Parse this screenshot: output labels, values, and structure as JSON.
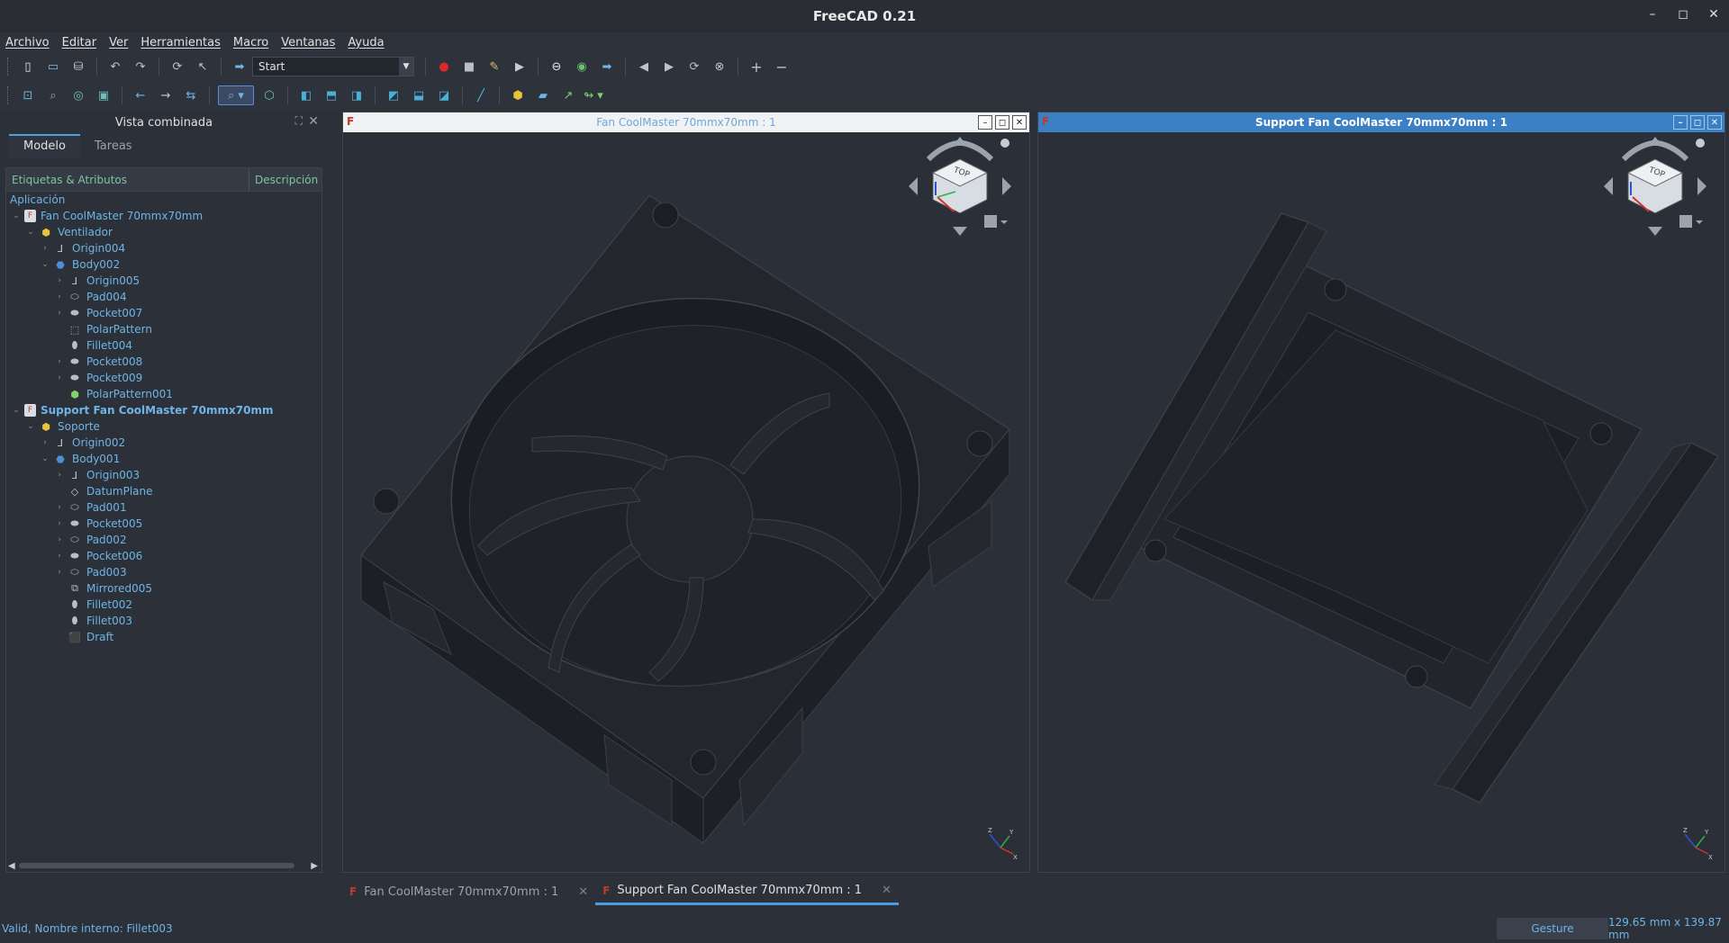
{
  "window": {
    "title": "FreeCAD 0.21"
  },
  "menu": [
    "Archivo",
    "Editar",
    "Ver",
    "Herramientas",
    "Macro",
    "Ventanas",
    "Ayuda"
  ],
  "toolbar": {
    "workbench": "Start"
  },
  "panel": {
    "title": "Vista combinada",
    "tabs": [
      "Modelo",
      "Tareas"
    ],
    "col_labels": "Etiquetas & Atributos",
    "col_desc": "Descripción",
    "app_label": "Aplicación"
  },
  "tree": [
    {
      "label": "Fan CoolMaster 70mmx70mm",
      "icon": "doc-icon",
      "depth": 0,
      "expanded": true,
      "bold": false
    },
    {
      "label": "Ventilador",
      "icon": "part-icon",
      "depth": 1,
      "expanded": true,
      "bold": false
    },
    {
      "label": "Origin004",
      "icon": "origin-icon",
      "depth": 2,
      "expander": "collapsed",
      "bold": false
    },
    {
      "label": "Body002",
      "icon": "body-icon",
      "depth": 2,
      "expanded": true,
      "bold": false
    },
    {
      "label": "Origin005",
      "icon": "origin-icon",
      "depth": 3,
      "expander": "collapsed",
      "bold": false
    },
    {
      "label": "Pad004",
      "icon": "pad-icon",
      "depth": 3,
      "expander": "collapsed",
      "bold": false
    },
    {
      "label": "Pocket007",
      "icon": "pocket-icon",
      "depth": 3,
      "expander": "collapsed",
      "bold": false
    },
    {
      "label": "PolarPattern",
      "icon": "polar-pattern-icon",
      "depth": 3,
      "expander": "none",
      "bold": false
    },
    {
      "label": "Fillet004",
      "icon": "fillet-icon",
      "depth": 3,
      "expander": "none",
      "bold": false
    },
    {
      "label": "Pocket008",
      "icon": "pocket-icon",
      "depth": 3,
      "expander": "collapsed",
      "bold": false
    },
    {
      "label": "Pocket009",
      "icon": "pocket-icon",
      "depth": 3,
      "expander": "collapsed",
      "bold": false
    },
    {
      "label": "PolarPattern001",
      "icon": "polar-pattern-tip-icon",
      "depth": 3,
      "expander": "none",
      "bold": false
    },
    {
      "label": "Support Fan CoolMaster 70mmx70mm",
      "icon": "doc-icon",
      "depth": 0,
      "expanded": true,
      "bold": true
    },
    {
      "label": "Soporte",
      "icon": "part-icon",
      "depth": 1,
      "expanded": true,
      "bold": false
    },
    {
      "label": "Origin002",
      "icon": "origin-icon",
      "depth": 2,
      "expander": "collapsed",
      "bold": false
    },
    {
      "label": "Body001",
      "icon": "body-icon",
      "depth": 2,
      "expanded": true,
      "bold": false
    },
    {
      "label": "Origin003",
      "icon": "origin-icon",
      "depth": 3,
      "expander": "collapsed",
      "bold": false
    },
    {
      "label": "DatumPlane",
      "icon": "datum-plane-icon",
      "depth": 3,
      "expander": "none",
      "bold": false
    },
    {
      "label": "Pad001",
      "icon": "pad-icon",
      "depth": 3,
      "expander": "collapsed",
      "bold": false
    },
    {
      "label": "Pocket005",
      "icon": "pocket-icon",
      "depth": 3,
      "expander": "collapsed",
      "bold": false
    },
    {
      "label": "Pad002",
      "icon": "pad-icon",
      "depth": 3,
      "expander": "collapsed",
      "bold": false
    },
    {
      "label": "Pocket006",
      "icon": "pocket-icon",
      "depth": 3,
      "expander": "collapsed",
      "bold": false
    },
    {
      "label": "Pad003",
      "icon": "pad-icon",
      "depth": 3,
      "expander": "collapsed",
      "bold": false
    },
    {
      "label": "Mirrored005",
      "icon": "mirrored-icon",
      "depth": 3,
      "expander": "none",
      "bold": false
    },
    {
      "label": "Fillet002",
      "icon": "fillet-icon",
      "depth": 3,
      "expander": "none",
      "bold": false
    },
    {
      "label": "Fillet003",
      "icon": "fillet-icon",
      "depth": 3,
      "expander": "none",
      "bold": false
    },
    {
      "label": "Draft",
      "icon": "draft-icon",
      "depth": 3,
      "expander": "none",
      "bold": false
    }
  ],
  "views": [
    {
      "title": "Fan CoolMaster 70mmx70mm : 1",
      "active": false
    },
    {
      "title": "Support Fan CoolMaster 70mmx70mm : 1",
      "active": true
    }
  ],
  "navcube": {
    "face": "TOP"
  },
  "doc_tabs": [
    {
      "label": "Fan CoolMaster 70mmx70mm : 1",
      "active": false
    },
    {
      "label": "Support Fan CoolMaster 70mmx70mm : 1",
      "active": true
    }
  ],
  "status": {
    "message": "Valid, Nombre interno: Fillet003",
    "nav_style": "Gesture",
    "dimensions": "129.65 mm x 139.87 mm"
  },
  "colors": {
    "accent": "#3b7fc4",
    "tree_text": "#6fb4e6",
    "header_text": "#7ec3a0"
  }
}
